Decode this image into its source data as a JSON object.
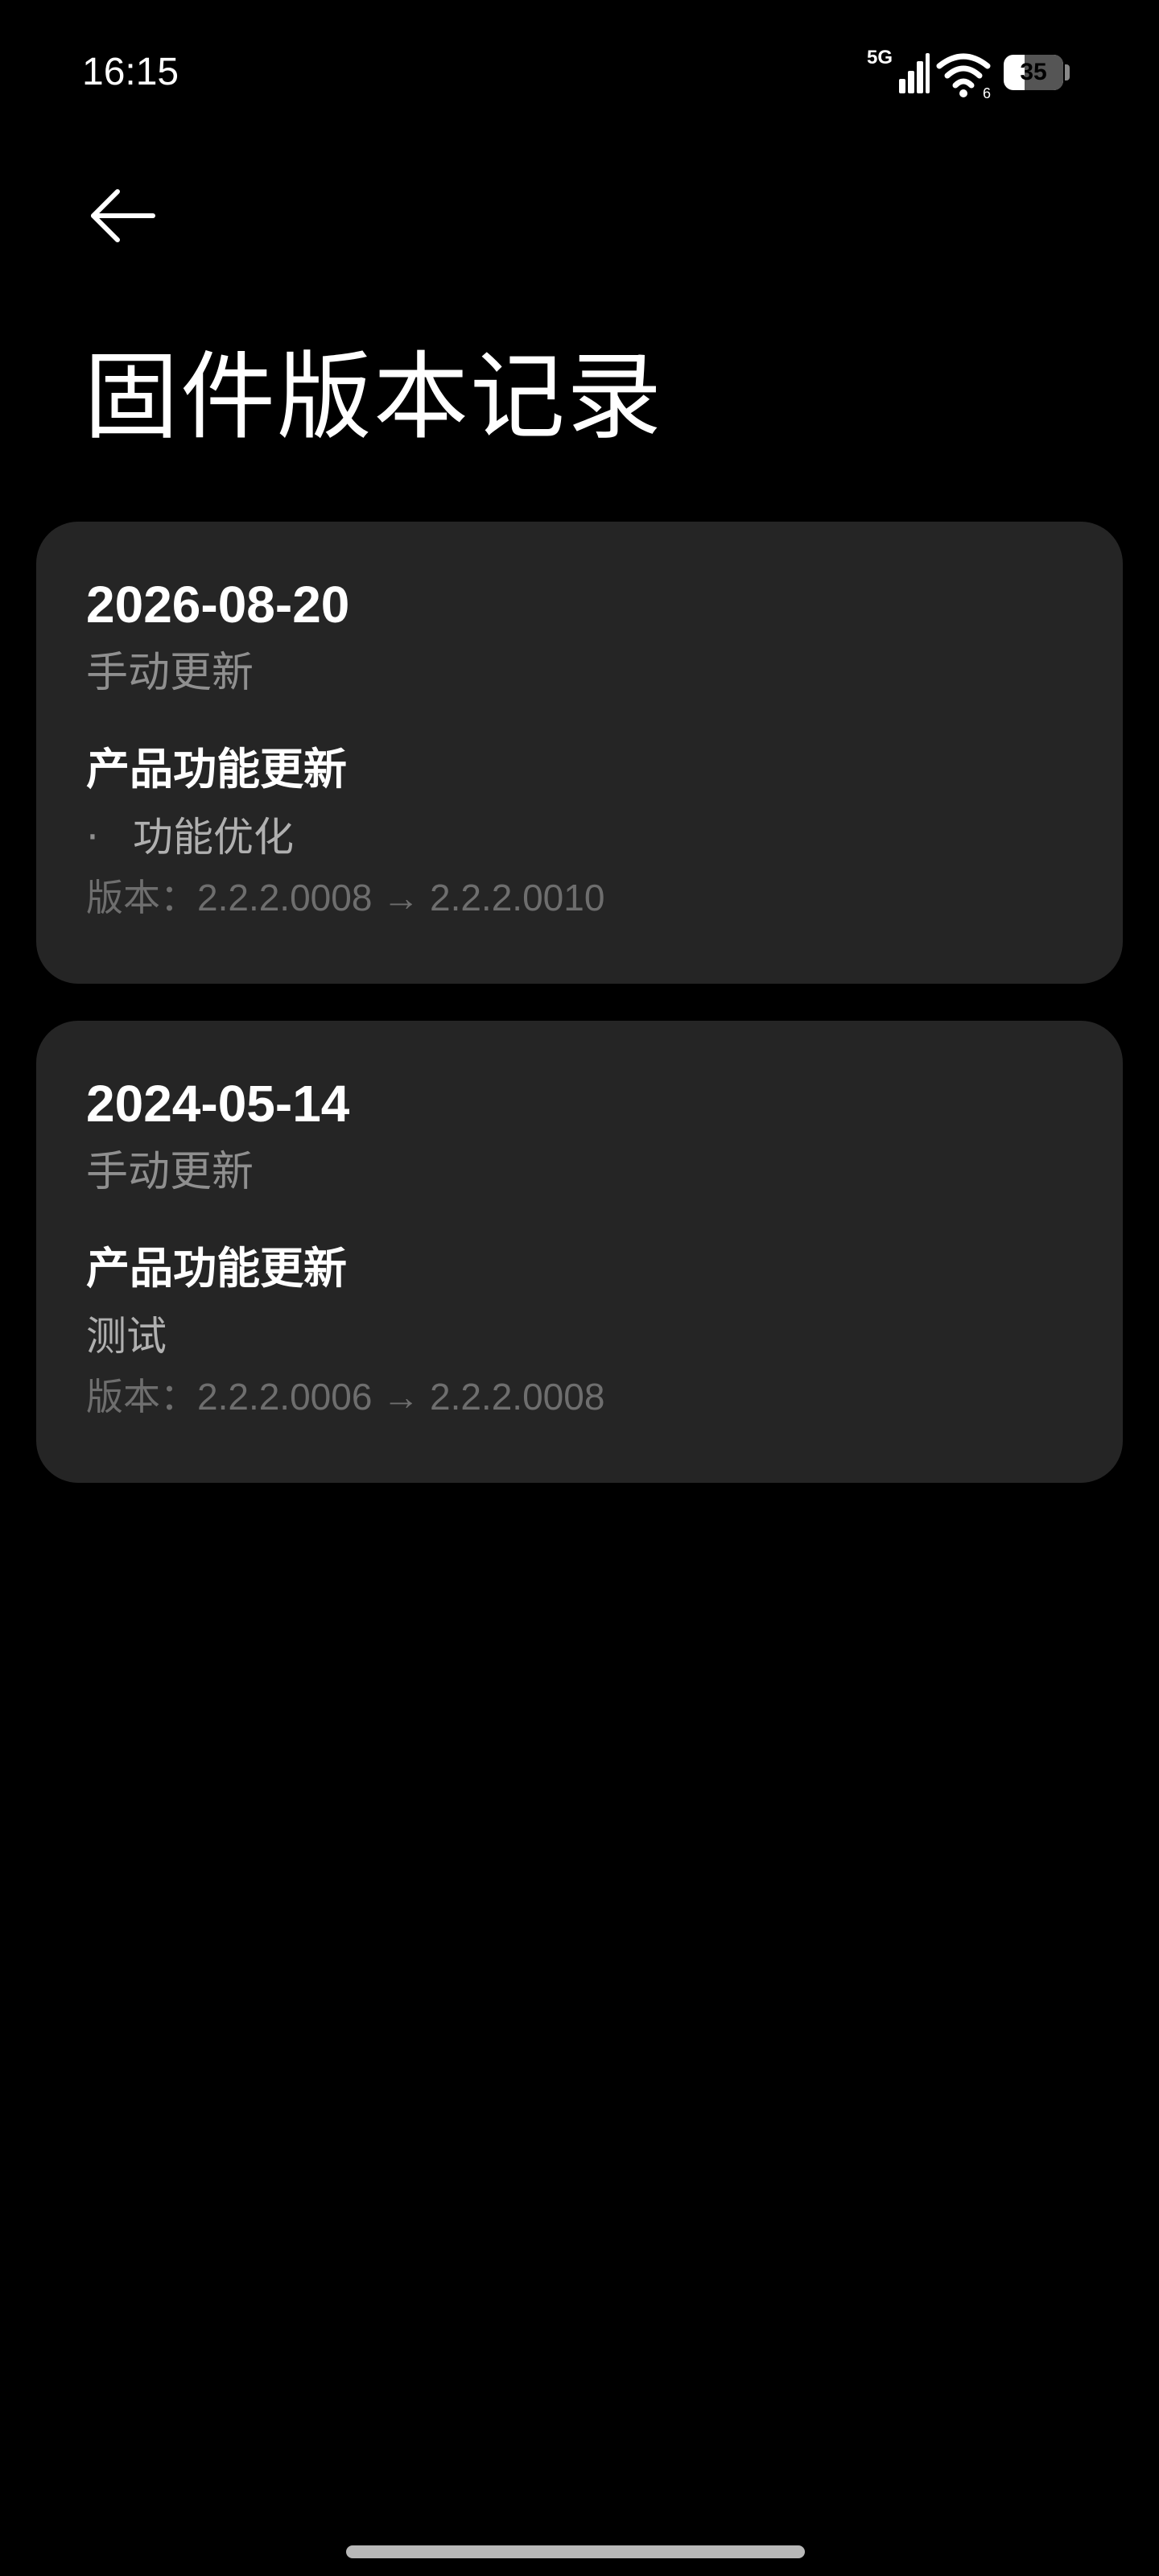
{
  "status_bar": {
    "time": "16:15",
    "network_label": "5G",
    "wifi_badge": "6",
    "battery_level": "35",
    "battery_fraction": 0.35,
    "icons": [
      "signal-icon",
      "wifi-icon",
      "battery-icon"
    ]
  },
  "header": {
    "back_icon": "arrow-left-icon",
    "title": "固件版本记录"
  },
  "records": [
    {
      "date": "2026-08-20",
      "update_type": "手动更新",
      "section_title": "产品功能更新",
      "bullet": "·",
      "detail": "功能优化",
      "version_label": "版本：",
      "version_range": "2.2.2.0008 → 2.2.2.0010"
    },
    {
      "date": "2024-05-14",
      "update_type": "手动更新",
      "section_title": "产品功能更新",
      "detail": "测试",
      "version_label": "版本：",
      "version_range": "2.2.2.0006 → 2.2.2.0008"
    }
  ],
  "colors": {
    "background": "#000000",
    "card": "#252525",
    "primary_text": "#ffffff",
    "secondary_text": "#8f8f8f",
    "muted_text": "#6e6e6e"
  }
}
